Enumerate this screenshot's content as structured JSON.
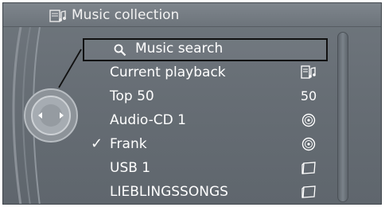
{
  "header": {
    "title": "Music collection",
    "icon": "music-collection-icon"
  },
  "menu": {
    "items": [
      {
        "label": "Music search",
        "icon": "search-icon",
        "selected": true
      },
      {
        "label": "Current playback",
        "right_icon": "current-playback-icon"
      },
      {
        "label": "Top 50",
        "right_text": "50"
      },
      {
        "label": "Audio-CD 1",
        "right_icon": "cd-icon"
      },
      {
        "label": "Frank",
        "right_icon": "cd-icon",
        "checked": true,
        "check_mark": "✓"
      },
      {
        "label": "USB 1",
        "right_icon": "folder-icon"
      },
      {
        "label": "LIEBLINGSSONGS",
        "right_icon": "folder-icon"
      }
    ]
  },
  "controller": {
    "icon": "controller-knob-icon"
  },
  "colors": {
    "screen_bg": "#666d74",
    "header_bg": "#767d84",
    "text": "#ffffff",
    "selection_border": "#111111"
  }
}
